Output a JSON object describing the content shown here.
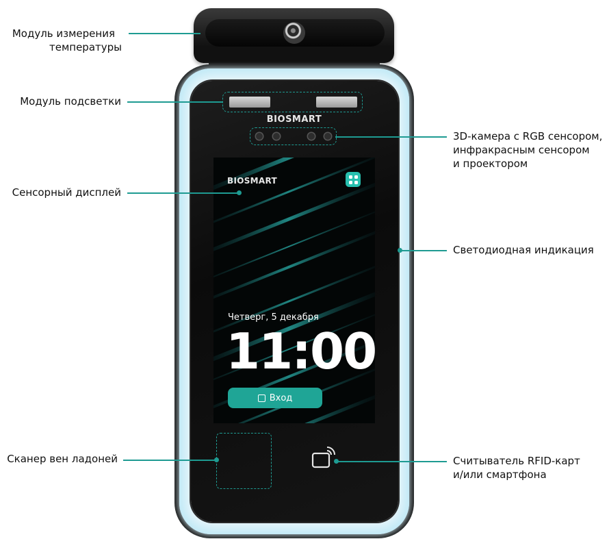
{
  "labels": {
    "temperature_module": [
      "Модуль измерения",
      "температуры"
    ],
    "illumination_module": "Модуль подсветки",
    "camera_3d": [
      "3D-камера с RGB сенсором,",
      "инфракрасным сенсором",
      "и проектором"
    ],
    "touch_display": "Сенсорный дисплей",
    "led_indication": "Светодиодная индикация",
    "palm_scanner": "Сканер вен ладоней",
    "rfid_reader": [
      "Считыватель RFID-карт",
      "и/или смартфона"
    ]
  },
  "device": {
    "brand": "BIOSMART",
    "screen": {
      "brand": "BIOSMART",
      "date": "Четверг, 5 декабря",
      "time": "11:00",
      "login_label": "Вход"
    }
  },
  "colors": {
    "accent": "#1e9b92",
    "button": "#1fa596",
    "led_glow": "#bfe9f6"
  }
}
